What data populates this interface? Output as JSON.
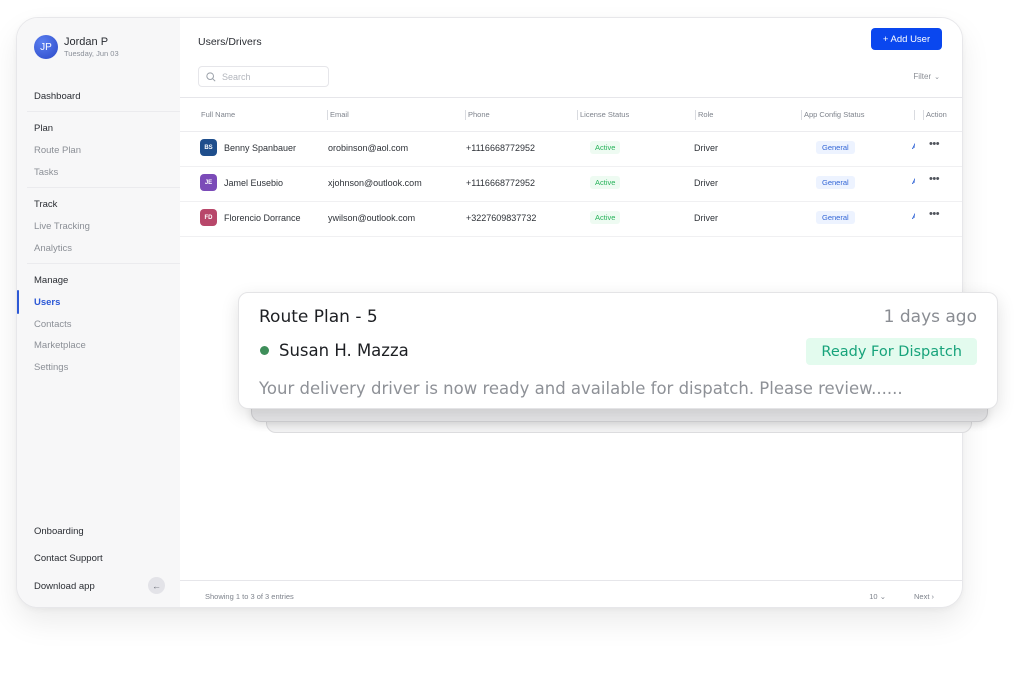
{
  "profile": {
    "initials": "JP",
    "name": "Jordan P",
    "date": "Tuesday, Jun 03"
  },
  "sidebar": {
    "dashboard": "Dashboard",
    "sections": [
      {
        "heading": "Plan",
        "items": [
          "Route Plan",
          "Tasks"
        ]
      },
      {
        "heading": "Track",
        "items": [
          "Live Tracking",
          "Analytics"
        ]
      },
      {
        "heading": "Manage",
        "items": [
          "Users",
          "Contacts",
          "Marketplace",
          "Settings"
        ]
      }
    ],
    "active_item": "Users",
    "bottom": [
      "Onboarding",
      "Contact Support",
      "Download app"
    ],
    "collapse_icon": "arrow-left-icon"
  },
  "header": {
    "title": "Users/Drivers",
    "add_user_label": "+ Add User"
  },
  "search": {
    "placeholder": "Search",
    "value": ""
  },
  "filter": {
    "label": "Filter"
  },
  "table": {
    "columns": [
      "Full Name",
      "Email",
      "Phone",
      "License Status",
      "Role",
      "App Config Status",
      "",
      "Action"
    ],
    "rows": [
      {
        "initials": "BS",
        "avatar_color": "#1f4e8c",
        "name": "Benny Spanbauer",
        "email": "orobinson@aol.com",
        "phone": "+1116668772952",
        "license_status": "Active",
        "role": "Driver",
        "app_config_status": "General",
        "truncated": "A"
      },
      {
        "initials": "JE",
        "avatar_color": "#7b4bb8",
        "name": "Jamel Eusebio",
        "email": "xjohnson@outlook.com",
        "phone": "+1116668772952",
        "license_status": "Active",
        "role": "Driver",
        "app_config_status": "General",
        "truncated": "A"
      },
      {
        "initials": "FD",
        "avatar_color": "#b8476a",
        "name": "Florencio Dorrance",
        "email": "ywilson@outlook.com",
        "phone": "+3227609837732",
        "license_status": "Active",
        "role": "Driver",
        "app_config_status": "General",
        "truncated": "A"
      }
    ]
  },
  "footer": {
    "summary": "Showing 1 to 3 of 3 entries",
    "page_size": "10",
    "next_label": "Next"
  },
  "notification": {
    "title": "Route Plan - 5",
    "time": "1 days ago",
    "driver": "Susan H. Mazza",
    "status": "Ready For Dispatch",
    "message": "Your delivery driver is now ready and available for dispatch. Please review......",
    "colors": {
      "status_bg": "#e3fbee",
      "status_text": "#17a37b",
      "dot": "#3e8e5a"
    }
  },
  "colors": {
    "accent": "#0a47ef",
    "active_nav": "#2d59d6",
    "active_badge": "#27b35a",
    "general_badge": "#3366d6"
  }
}
